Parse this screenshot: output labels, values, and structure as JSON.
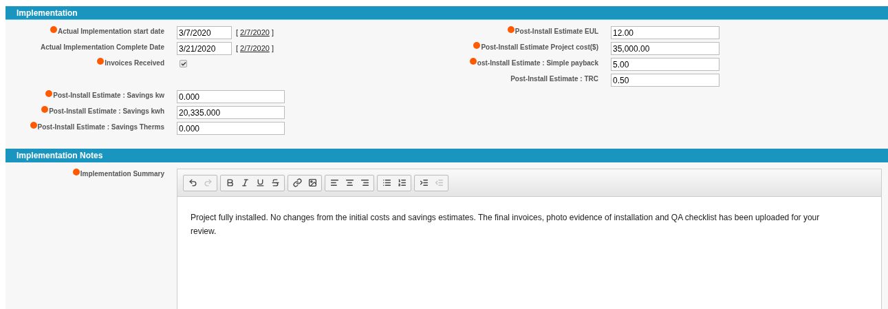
{
  "implementation": {
    "title": "Implementation",
    "left_fields": [
      {
        "kind": "date",
        "label": "Actual Implementation start date",
        "required": true,
        "value": "3/7/2020",
        "open": "[",
        "link": "2/7/2020",
        "close": "]"
      },
      {
        "kind": "date",
        "label": "Actual Implementation Complete Date",
        "required": false,
        "value": "3/21/2020",
        "open": "[",
        "link": "2/7/2020",
        "close": "]"
      },
      {
        "kind": "checkbox",
        "label": "Invoices Received",
        "required": true,
        "checked": true
      }
    ],
    "savings_fields": [
      {
        "kind": "text",
        "label": "Post-Install Estimate : Savings kw",
        "required": true,
        "value": "0.000"
      },
      {
        "kind": "text",
        "label": "Post-Install Estimate : Savings kwh",
        "required": true,
        "value": "20,335.000"
      },
      {
        "kind": "text",
        "label": "Post-Install Estimate : Savings Therms",
        "required": true,
        "value": "0.000"
      }
    ],
    "right_fields": [
      {
        "kind": "text",
        "label": "Post-Install Estimate EUL",
        "required": true,
        "value": "12.00"
      },
      {
        "kind": "text",
        "label": "Post-Install Estimate Project cost($)",
        "required": true,
        "value": "35,000.00"
      },
      {
        "kind": "text",
        "label": "ost-Install Estimate : Simple payback",
        "required": true,
        "value": "5.00"
      },
      {
        "kind": "text",
        "label": "Post-Install Estimate : TRC",
        "required": false,
        "value": "0.50"
      }
    ]
  },
  "notes": {
    "title": "Implementation Notes",
    "label": "Implementation Summary",
    "required": true,
    "toolbar": [
      [
        {
          "kind": "undo",
          "disabled": false
        },
        {
          "kind": "redo",
          "disabled": true
        }
      ],
      [
        {
          "kind": "bold",
          "disabled": false
        },
        {
          "kind": "italic",
          "disabled": false
        },
        {
          "kind": "underline",
          "disabled": false
        },
        {
          "kind": "strikethrough",
          "disabled": false
        }
      ],
      [
        {
          "kind": "link",
          "disabled": false
        },
        {
          "kind": "image",
          "disabled": false
        }
      ],
      [
        {
          "kind": "align-left",
          "disabled": false
        },
        {
          "kind": "align-center",
          "disabled": false
        },
        {
          "kind": "align-right",
          "disabled": false
        }
      ],
      [
        {
          "kind": "bullet-list",
          "disabled": false
        },
        {
          "kind": "numbered-list",
          "disabled": false
        }
      ],
      [
        {
          "kind": "indent",
          "disabled": false
        },
        {
          "kind": "outdent",
          "disabled": true
        }
      ]
    ],
    "text": "Project fully installed. No changes from the initial costs and savings estimates. The final invoices, photo evidence of installation and QA checklist has been uploaded for your review."
  }
}
